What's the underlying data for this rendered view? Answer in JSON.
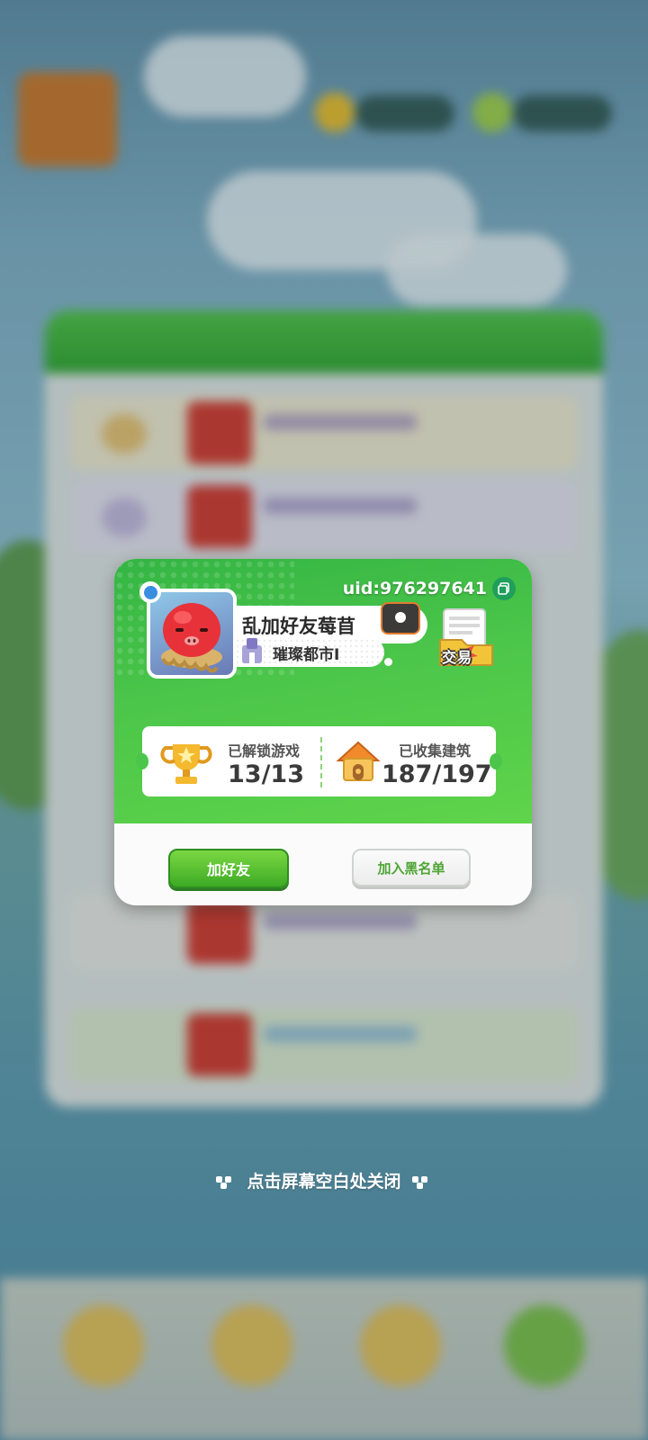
{
  "profile": {
    "uid": "uid:976297641",
    "name": "乱加好友莓苜",
    "city": "璀璨都市I"
  },
  "trade": {
    "label": "交易"
  },
  "stats": {
    "games_label": "已解锁游戏",
    "games_value": "13/13",
    "buildings_label": "已收集建筑",
    "buildings_value": "187/197"
  },
  "actions": {
    "add_friend": "加好友",
    "add_blacklist": "加入黑名单"
  },
  "hint": "点击屏幕空白处关闭",
  "colors": {
    "header_green": "#4cc64a",
    "button_green": "#3cab25",
    "copy_button": "#1f9f5b"
  },
  "icons": {
    "copy": "copy-icon",
    "gender": "male-icon",
    "trophy": "trophy-icon",
    "house": "house-icon",
    "trade": "trade-folder-icon"
  }
}
